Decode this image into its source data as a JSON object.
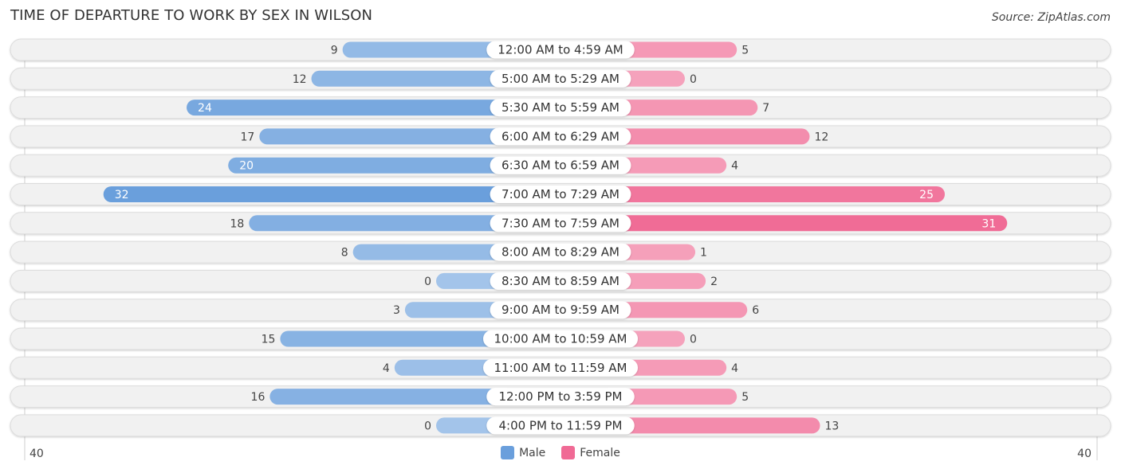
{
  "header": {
    "title": "TIME OF DEPARTURE TO WORK BY SEX IN WILSON",
    "source": "Source: ZipAtlas.com"
  },
  "legend": {
    "male_label": "Male",
    "female_label": "Female"
  },
  "axis": {
    "left_label": "40",
    "right_label": "40"
  },
  "colors": {
    "male": "#6a9fdc",
    "male_light": "#a9c8eb",
    "female": "#f06a95",
    "female_light": "#f6a8c0",
    "row_bg": "#f1f1f1"
  },
  "chart_data": {
    "type": "bar",
    "orientation": "horizontal-diverging",
    "title": "TIME OF DEPARTURE TO WORK BY SEX IN WILSON",
    "categories": [
      "12:00 AM to 4:59 AM",
      "5:00 AM to 5:29 AM",
      "5:30 AM to 5:59 AM",
      "6:00 AM to 6:29 AM",
      "6:30 AM to 6:59 AM",
      "7:00 AM to 7:29 AM",
      "7:30 AM to 7:59 AM",
      "8:00 AM to 8:29 AM",
      "8:30 AM to 8:59 AM",
      "9:00 AM to 9:59 AM",
      "10:00 AM to 10:59 AM",
      "11:00 AM to 11:59 AM",
      "12:00 PM to 3:59 PM",
      "4:00 PM to 11:59 PM"
    ],
    "series": [
      {
        "name": "Male",
        "values": [
          9,
          12,
          24,
          17,
          20,
          32,
          18,
          8,
          0,
          3,
          15,
          4,
          16,
          0
        ]
      },
      {
        "name": "Female",
        "values": [
          5,
          0,
          7,
          12,
          4,
          25,
          31,
          1,
          2,
          6,
          0,
          4,
          5,
          13
        ]
      }
    ],
    "xlim": [
      -40,
      40
    ],
    "xlabel": "",
    "ylabel": "",
    "legend_position": "bottom-center"
  }
}
